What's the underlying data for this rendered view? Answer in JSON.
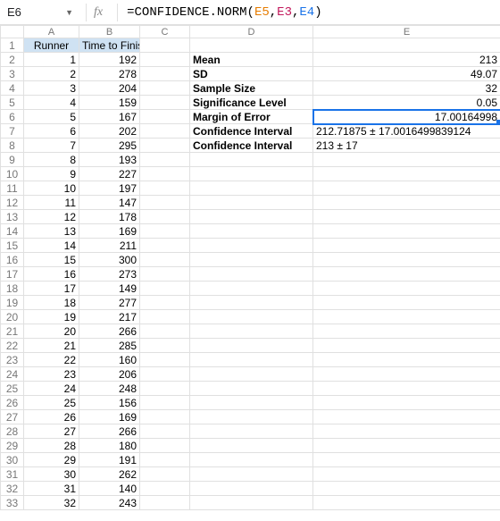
{
  "name_box": "E6",
  "formula": {
    "prefix": "=",
    "fn": "CONFIDENCE.NORM",
    "open": "(",
    "arg1": "E5",
    "sep1": ",",
    "arg2": "E3",
    "sep2": ",",
    "arg3": "E4",
    "close": ")"
  },
  "col_headers": {
    "A": "A",
    "B": "B",
    "C": "C",
    "D": "D",
    "E": "E"
  },
  "headers": {
    "runner": "Runner",
    "time": "Time to Finish"
  },
  "labels": {
    "mean": "Mean",
    "sd": "SD",
    "sample_size": "Sample Size",
    "sig": "Significance Level",
    "moe": "Margin of Error",
    "ci1": "Confidence Interval",
    "ci2": "Confidence Interval"
  },
  "values": {
    "mean": "213",
    "sd": "49.07",
    "sample_size": "32",
    "sig": "0.05",
    "moe": "17.00164998",
    "ci1": "212.71875 ± 17.0016499839124",
    "ci2": "213 ± 17"
  },
  "rows": [
    {
      "n": "1",
      "r": "1",
      "t": "192"
    },
    {
      "n": "2",
      "r": "2",
      "t": "278"
    },
    {
      "n": "3",
      "r": "3",
      "t": "204"
    },
    {
      "n": "4",
      "r": "4",
      "t": "159"
    },
    {
      "n": "5",
      "r": "5",
      "t": "167"
    },
    {
      "n": "6",
      "r": "6",
      "t": "202"
    },
    {
      "n": "7",
      "r": "7",
      "t": "295"
    },
    {
      "n": "8",
      "r": "8",
      "t": "193"
    },
    {
      "n": "9",
      "r": "9",
      "t": "227"
    },
    {
      "n": "10",
      "r": "10",
      "t": "197"
    },
    {
      "n": "11",
      "r": "11",
      "t": "147"
    },
    {
      "n": "12",
      "r": "12",
      "t": "178"
    },
    {
      "n": "13",
      "r": "13",
      "t": "169"
    },
    {
      "n": "14",
      "r": "14",
      "t": "211"
    },
    {
      "n": "15",
      "r": "15",
      "t": "300"
    },
    {
      "n": "16",
      "r": "16",
      "t": "273"
    },
    {
      "n": "17",
      "r": "17",
      "t": "149"
    },
    {
      "n": "18",
      "r": "18",
      "t": "277"
    },
    {
      "n": "19",
      "r": "19",
      "t": "217"
    },
    {
      "n": "20",
      "r": "20",
      "t": "266"
    },
    {
      "n": "21",
      "r": "21",
      "t": "285"
    },
    {
      "n": "22",
      "r": "22",
      "t": "160"
    },
    {
      "n": "23",
      "r": "23",
      "t": "206"
    },
    {
      "n": "24",
      "r": "24",
      "t": "248"
    },
    {
      "n": "25",
      "r": "25",
      "t": "156"
    },
    {
      "n": "26",
      "r": "26",
      "t": "169"
    },
    {
      "n": "27",
      "r": "27",
      "t": "266"
    },
    {
      "n": "28",
      "r": "28",
      "t": "180"
    },
    {
      "n": "29",
      "r": "29",
      "t": "191"
    },
    {
      "n": "30",
      "r": "30",
      "t": "262"
    },
    {
      "n": "31",
      "r": "31",
      "t": "140"
    },
    {
      "n": "32",
      "r": "32",
      "t": "243"
    }
  ]
}
